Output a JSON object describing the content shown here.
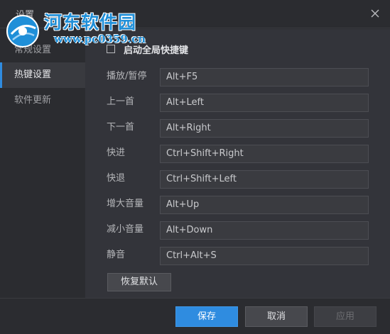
{
  "window": {
    "title": "设置",
    "close_icon": "close-icon"
  },
  "watermark": {
    "name": "河东软件园",
    "url": "www.pc0359.cn"
  },
  "sidebar": {
    "items": [
      {
        "label": "常规设置",
        "active": false
      },
      {
        "label": "热键设置",
        "active": true
      },
      {
        "label": "软件更新",
        "active": false
      }
    ]
  },
  "hotkeys": {
    "global_toggle_label": "启动全局快捷键",
    "global_toggle_checked": false,
    "rows": [
      {
        "label": "播放/暂停",
        "value": "Alt+F5"
      },
      {
        "label": "上一首",
        "value": "Alt+Left"
      },
      {
        "label": "下一首",
        "value": "Alt+Right"
      },
      {
        "label": "快进",
        "value": "Ctrl+Shift+Right"
      },
      {
        "label": "快退",
        "value": "Ctrl+Shift+Left"
      },
      {
        "label": "增大音量",
        "value": "Alt+Up"
      },
      {
        "label": "减小音量",
        "value": "Alt+Down"
      },
      {
        "label": "静音",
        "value": "Ctrl+Alt+S"
      }
    ],
    "restore_label": "恢复默认"
  },
  "footer": {
    "save_label": "保存",
    "cancel_label": "取消",
    "apply_label": "应用"
  },
  "colors": {
    "accent": "#2f8ce0",
    "background": "#2b2c30",
    "panel": "#33343a"
  }
}
